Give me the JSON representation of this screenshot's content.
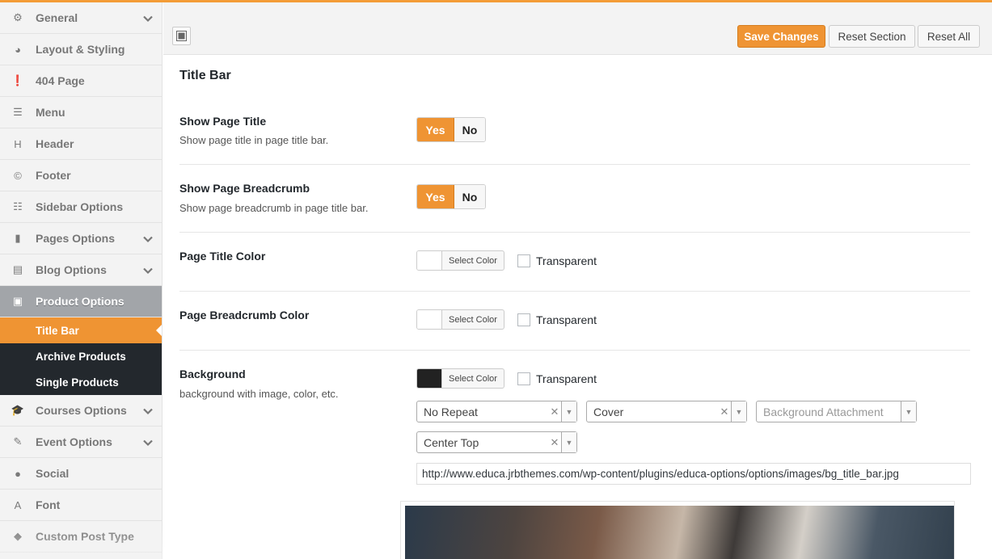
{
  "sidebar": {
    "items": [
      {
        "label": "General",
        "icon": "gears-icon",
        "glyph": "⚙",
        "chevron": true
      },
      {
        "label": "Layout & Styling",
        "icon": "palette-icon",
        "glyph": "◕",
        "chevron": false
      },
      {
        "label": "404 Page",
        "icon": "exclamation-circle-icon",
        "glyph": "❗",
        "chevron": false
      },
      {
        "label": "Menu",
        "icon": "menu-icon",
        "glyph": "☰",
        "chevron": false
      },
      {
        "label": "Header",
        "icon": "header-icon",
        "glyph": "H",
        "chevron": false
      },
      {
        "label": "Footer",
        "icon": "copyright-icon",
        "glyph": "©",
        "chevron": false
      },
      {
        "label": "Sidebar Options",
        "icon": "list-icon",
        "glyph": "☷",
        "chevron": false
      },
      {
        "label": "Pages Options",
        "icon": "file-icon",
        "glyph": "▮",
        "chevron": true
      },
      {
        "label": "Blog Options",
        "icon": "document-icon",
        "glyph": "▤",
        "chevron": true
      },
      {
        "label": "Product Options",
        "icon": "shopping-bag-icon",
        "glyph": "▣",
        "chevron": false,
        "active": true
      }
    ],
    "subitems": [
      {
        "label": "Title Bar",
        "active": true
      },
      {
        "label": "Archive Products"
      },
      {
        "label": "Single Products"
      }
    ],
    "items_after": [
      {
        "label": "Courses Options",
        "icon": "graduation-cap-icon",
        "glyph": "🎓",
        "chevron": true
      },
      {
        "label": "Event Options",
        "icon": "edit-icon",
        "glyph": "✎",
        "chevron": true
      },
      {
        "label": "Social",
        "icon": "globe-icon",
        "glyph": "●",
        "chevron": false
      },
      {
        "label": "Font",
        "icon": "font-icon",
        "glyph": "A",
        "chevron": false
      },
      {
        "label": "Custom Post Type",
        "icon": "tags-icon",
        "glyph": "◆",
        "chevron": false
      }
    ]
  },
  "toolbar": {
    "save_label": "Save Changes",
    "reset_section_label": "Reset Section",
    "reset_all_label": "Reset All"
  },
  "section": {
    "title": "Title Bar",
    "fields": {
      "show_title": {
        "title": "Show Page Title",
        "desc": "Show page title in page title bar.",
        "yes": "Yes",
        "no": "No"
      },
      "show_breadcrumb": {
        "title": "Show Page Breadcrumb",
        "desc": "Show page breadcrumb in page title bar.",
        "yes": "Yes",
        "no": "No"
      },
      "title_color": {
        "title": "Page Title Color",
        "select": "Select Color",
        "transparent": "Transparent"
      },
      "breadcrumb_color": {
        "title": "Page Breadcrumb Color",
        "select": "Select Color",
        "transparent": "Transparent"
      },
      "background": {
        "title": "Background",
        "desc": "background with image, color, etc.",
        "select": "Select Color",
        "transparent": "Transparent",
        "repeat": "No Repeat",
        "size": "Cover",
        "attachment_placeholder": "Background Attachment",
        "position": "Center Top",
        "url": "http://www.educa.jrbthemes.com/wp-content/plugins/educa-options/options/images/bg_title_bar.jpg"
      }
    }
  },
  "colors": {
    "accent": "#ef9433",
    "sidebar_bg": "#f3f3f3",
    "submenu_bg": "#23282d"
  }
}
